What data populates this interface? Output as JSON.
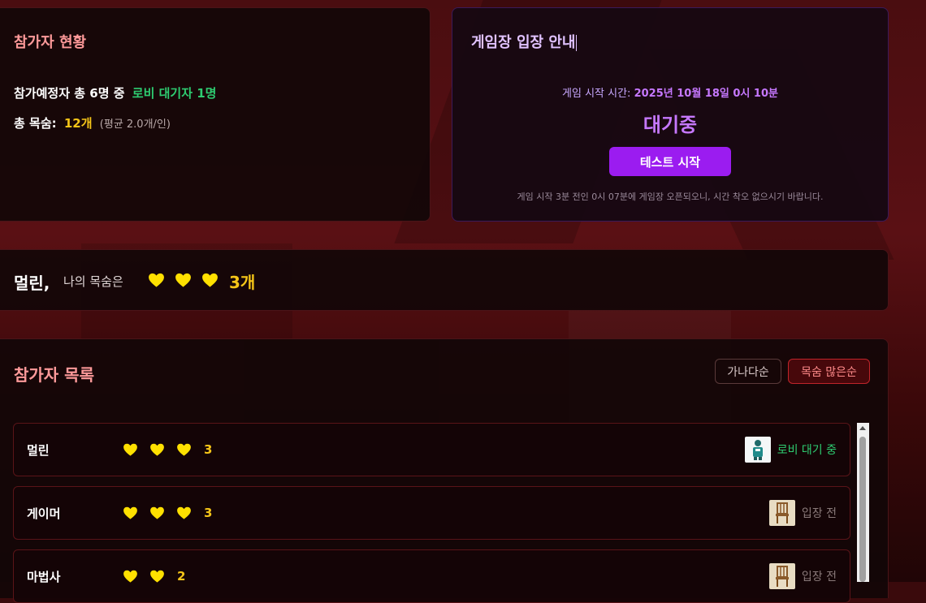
{
  "colors": {
    "accent_purple": "#9b1cf0",
    "lives_gold": "#f5c518",
    "lobby_green": "#2ecc71",
    "title_pink": "#ff9a9a",
    "heart_yellow": "#ffe000"
  },
  "status_panel": {
    "title": "참가자 현황",
    "expected_prefix": "참가예정자 총",
    "expected_count": "6명",
    "expected_mid": "중",
    "lobby_text": "로비 대기자 1명",
    "lives_label": "총 목숨:",
    "lives_total": "12개",
    "lives_avg": "(평균 2.0개/인)"
  },
  "entry_panel": {
    "title": "게임장 입장 안내",
    "start_label": "게임 시작 시간:",
    "start_time": "2025년 10월 18일 0시 10분",
    "state": "대기중",
    "test_button": "테스트 시작",
    "notice": "게임 시작 3분 전인 0시 07분에 게임장 오픈되오니, 시간 착오 없으시기 바랍니다."
  },
  "my_lives": {
    "name": "멀린,",
    "label": "나의 목숨은",
    "hearts": 3,
    "count_text": "3개"
  },
  "participants": {
    "title": "참가자 목록",
    "sort_options": [
      "가나다순",
      "목숨 많은순"
    ],
    "active_sort": "목숨 많은순",
    "rows": [
      {
        "name": "멀린",
        "hearts": 3,
        "count": "3",
        "status": "로비 대기 중",
        "status_type": "lobby",
        "icon": "player-avatar-icon"
      },
      {
        "name": "게이머",
        "hearts": 3,
        "count": "3",
        "status": "입장 전",
        "status_type": "pending",
        "icon": "chair-icon"
      },
      {
        "name": "마법사",
        "hearts": 2,
        "count": "2",
        "status": "입장 전",
        "status_type": "pending",
        "icon": "chair-icon"
      }
    ]
  }
}
